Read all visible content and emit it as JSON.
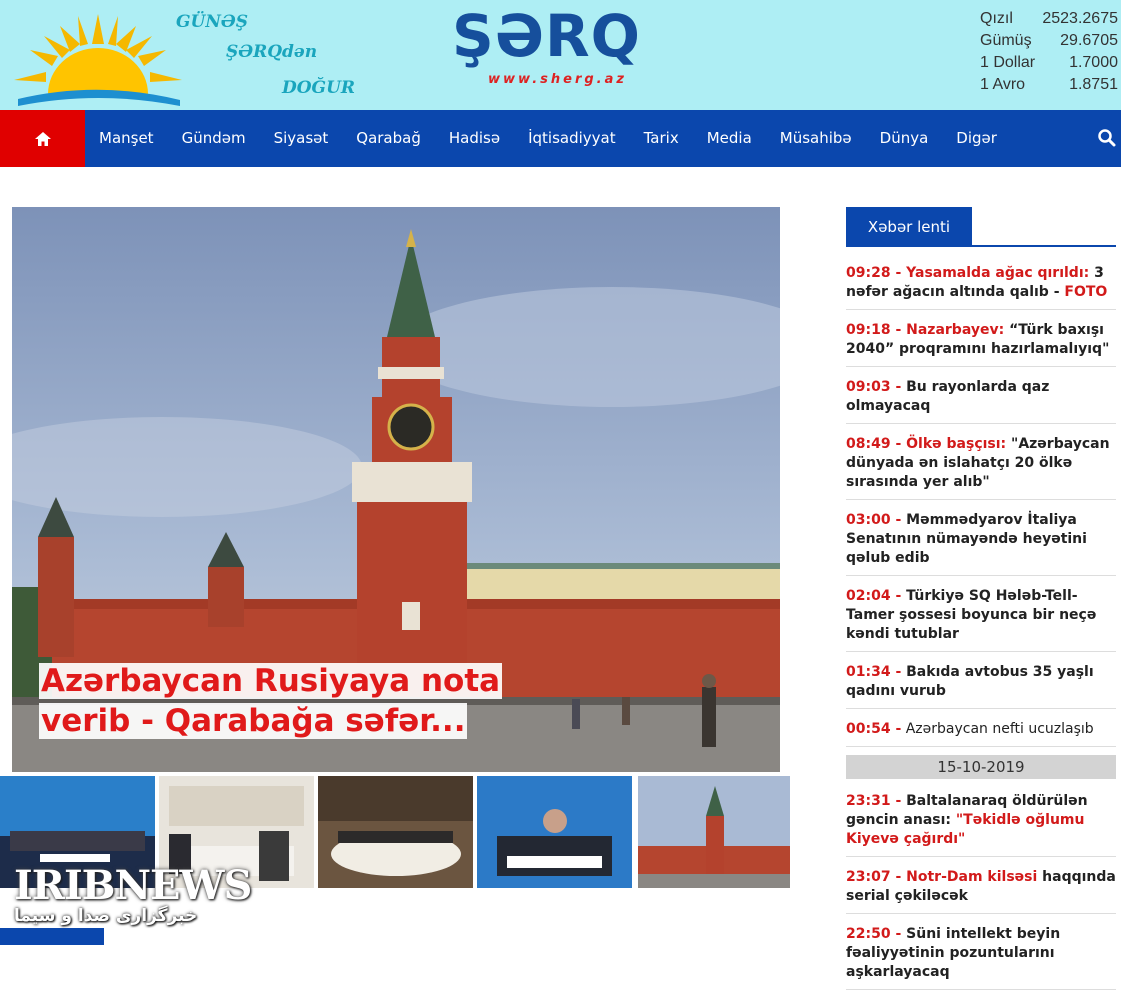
{
  "header": {
    "slogan": [
      "GÜNƏŞ",
      "ŞƏRQdən",
      "DOĞUR"
    ],
    "logo": "ŞƏRQ",
    "logo_url": "www.sherg.az",
    "rates": [
      {
        "name": "Qızıl",
        "value": "2523.2675"
      },
      {
        "name": "Gümüş",
        "value": "29.6705"
      },
      {
        "name": "1 Dollar",
        "value": "1.7000"
      },
      {
        "name": "1 Avro",
        "value": "1.8751"
      }
    ]
  },
  "nav": {
    "items": [
      "Manşet",
      "Gündəm",
      "Siyasət",
      "Qarabağ",
      "Hadisə",
      "İqtisadiyyat",
      "Tarix",
      "Media",
      "Müsahibə",
      "Dünya",
      "Digər"
    ],
    "colors": {
      "bar": "#0b47ad",
      "home": "#e00000"
    }
  },
  "hero": {
    "title_line1": "Azərbaycan Rusiyaya nota",
    "title_line2": "verib - Qarabağa səfər..."
  },
  "sidebar": {
    "tab": "Xəbər lenti",
    "news": [
      {
        "time": "09:28",
        "head": "Yasamalda ağac qırıldı:",
        "text": " 3 nəfər ağacın altında qalıb - ",
        "extra": "FOTO"
      },
      {
        "time": "09:18",
        "head": "Nazarbayev:",
        "text": " “Türk baxışı 2040” proqramını hazırlamalıyıq\"",
        "extra": ""
      },
      {
        "time": "09:03",
        "head": "",
        "text": " Bu rayonlarda qaz olmayacaq",
        "extra": ""
      },
      {
        "time": "08:49",
        "head": "Ölkə başçısı:",
        "text": " \"Azərbaycan dünyada ən islahatçı 20 ölkə sırasında yer alıb\"",
        "extra": ""
      },
      {
        "time": "03:00",
        "head": "",
        "text": " Məmmədyarov İtaliya Senatının nümayəndə heyətini qəlub edib",
        "extra": ""
      },
      {
        "time": "02:04",
        "head": "",
        "text": " Türkiyə SQ Hələb-Tell-Tamer şossesi boyunca bir neçə kəndi tutublar",
        "extra": ""
      },
      {
        "time": "01:34",
        "head": "",
        "text": " Bakıda avtobus 35 yaşlı qadını vurub",
        "extra": ""
      },
      {
        "time": "00:54",
        "head": "",
        "text": " Azərbaycan nefti ucuzlaşıb",
        "extra": ""
      }
    ],
    "date": "15-10-2019",
    "news2": [
      {
        "time": "23:31",
        "head": "",
        "text": " Baltalanaraq öldürülən gəncin anası: ",
        "extra": "\"Təkidlə oğlumu Kiyevə çağırdı\""
      },
      {
        "time": "23:07",
        "head": "Notr-Dam kilsəsi",
        "text": " haqqında serial çəkiləcək",
        "extra": ""
      },
      {
        "time": "22:50",
        "head": "",
        "text": " Süni intellekt beyin fəaliyyətinin pozuntularını aşkarlayacaq",
        "extra": ""
      }
    ]
  },
  "watermark": {
    "text": "IRIBNEWS",
    "sub": "خبرگزاری صدا و سیما"
  }
}
